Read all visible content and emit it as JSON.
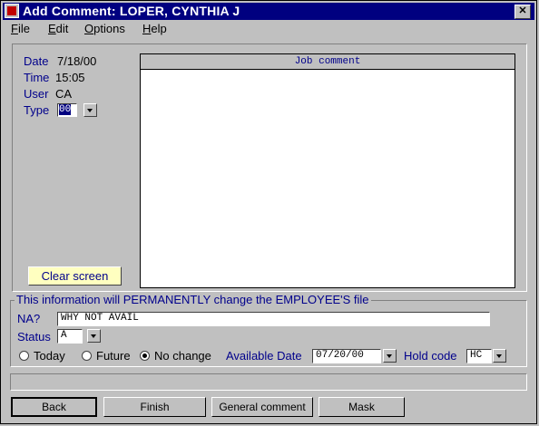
{
  "window": {
    "title": "Add Comment:  LOPER, CYNTHIA J",
    "close_glyph": "✕"
  },
  "menu": {
    "items": [
      {
        "u": "F",
        "rest": "ile"
      },
      {
        "u": "E",
        "rest": "dit"
      },
      {
        "u": "O",
        "rest": "ptions"
      },
      {
        "u": "H",
        "rest": "elp"
      }
    ]
  },
  "info": {
    "date_label": "Date",
    "date_value": "7/18/00",
    "time_label": "Time",
    "time_value": "15:05",
    "user_label": "User",
    "user_value": "CA",
    "type_label": "Type",
    "type_value": "00"
  },
  "clear_button": "Clear screen",
  "comment": {
    "header": "Job comment",
    "text": ""
  },
  "employee_group": {
    "legend": "This information will PERMANENTLY change the EMPLOYEE'S file",
    "na_label": "NA?",
    "na_value": "WHY NOT AVAIL",
    "status_label": "Status",
    "status_value": "A",
    "radio_today": "Today",
    "radio_future": "Future",
    "radio_nochange": "No change",
    "selected_radio": "No change",
    "avail_label": "Available Date",
    "avail_value": "07/20/00",
    "hold_label": "Hold code",
    "hold_value": "HC"
  },
  "status_bar": "",
  "buttons": {
    "back": "Back",
    "finish": "Finish",
    "general": "General comment",
    "mask": "Mask"
  },
  "colors": {
    "title_bar": "#000080",
    "label_blue": "#00008b",
    "clear_button_bg": "#ffffc0"
  }
}
